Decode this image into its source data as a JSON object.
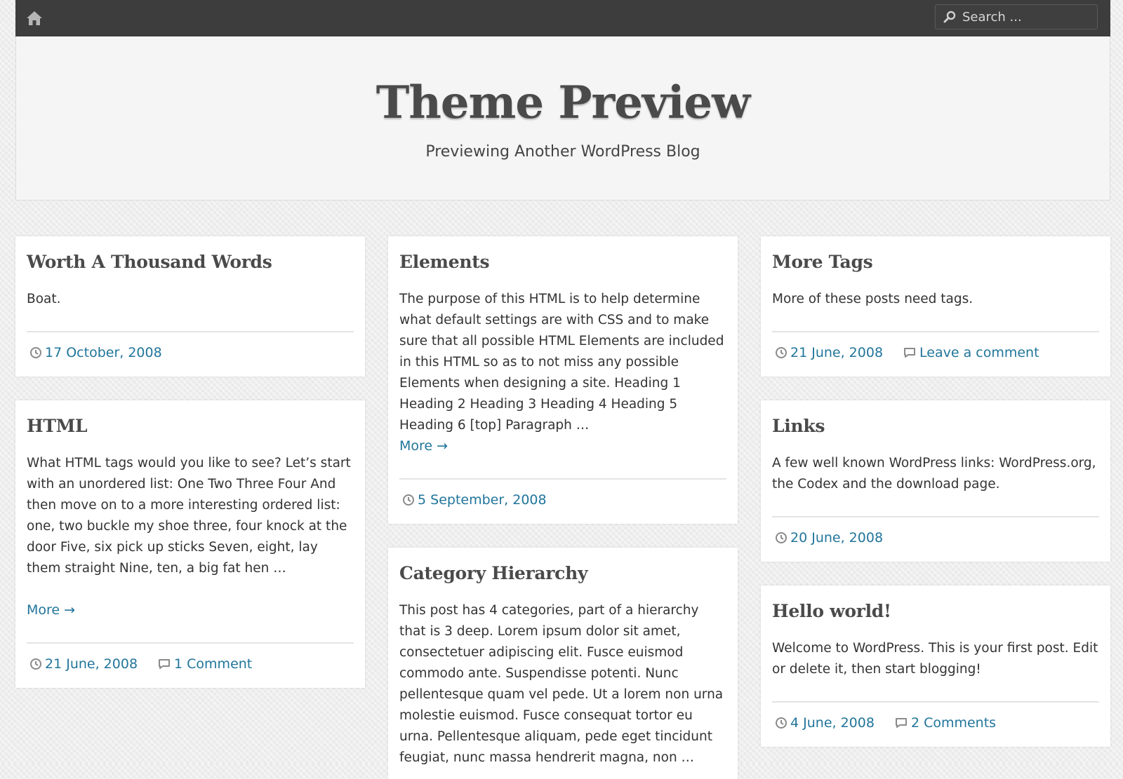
{
  "topbar": {
    "home_icon": "home-icon",
    "search": {
      "placeholder": "Search ...",
      "icon": "search-icon"
    }
  },
  "header": {
    "title": "Theme Preview",
    "description": "Previewing Another WordPress Blog"
  },
  "colors": {
    "link": "#21759b",
    "topbar": "#3d3d3d",
    "title": "#4a4a4a"
  },
  "posts": [
    {
      "title": "Worth A Thousand Words",
      "excerpt": "Boat.",
      "date": "17 October, 2008"
    },
    {
      "title": "HTML",
      "excerpt": "What HTML tags would you like to see? Let’s start with an unordered list: One Two Three Four And then move on to a more interesting ordered list: one, two buckle my shoe three, four knock at the door Five, six pick up sticks Seven, eight, lay them straight Nine, ten, a big fat hen …",
      "more": "More →",
      "date": "21 June, 2008",
      "comments": "1 Comment"
    },
    {
      "title": "Elements",
      "excerpt": "The purpose of this HTML is to help determine what default settings are with CSS and to make sure that all possible HTML Elements are included in this HTML so as to not miss any possible Elements when designing a site. Heading 1 Heading 2 Heading 3 Heading 4 Heading 5 Heading 6 [top] Paragraph …",
      "more": "More →",
      "date": "5 September, 2008"
    },
    {
      "title": "Category Hierarchy",
      "excerpt": "This post has 4 categories, part of a hierarchy that is 3 deep. Lorem ipsum dolor sit amet, consectetuer adipiscing elit. Fusce euismod commodo ante. Suspendisse potenti. Nunc pellentesque quam vel pede. Ut a lorem non urna molestie euismod. Fusce consequat tortor eu urna. Pellentesque aliquam, pede eget tincidunt feugiat, nunc massa hendrerit magna, non …"
    },
    {
      "title": "More Tags",
      "excerpt": "More of these posts need tags.",
      "date": "21 June, 2008",
      "comments": "Leave a comment"
    },
    {
      "title": "Links",
      "excerpt": "A few well known WordPress links: WordPress.org, the Codex and the download page.",
      "date": "20 June, 2008"
    },
    {
      "title": "Hello world!",
      "excerpt": "Welcome to WordPress. This is your first post. Edit or delete it, then start blogging!",
      "date": "4 June, 2008",
      "comments": "2 Comments"
    }
  ]
}
